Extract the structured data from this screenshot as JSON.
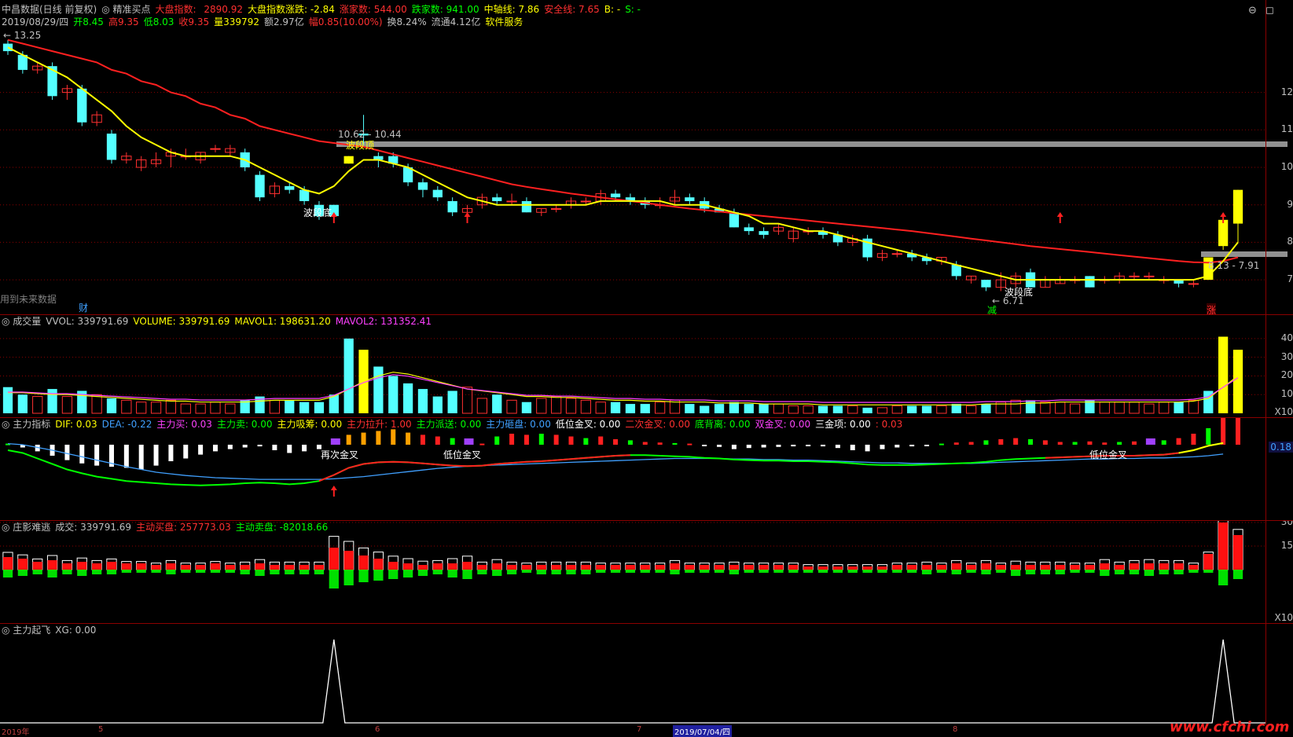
{
  "header": {
    "line1": [
      {
        "t": "中昌数据(日线 前复权)",
        "c": "#c0c0c0",
        "n": "stock-title"
      },
      {
        "t": "◎ 精准买点",
        "c": "#c0c0c0",
        "n": "indicator-name"
      },
      {
        "t": "大盘指数: ",
        "c": "#ff3030",
        "n": "index-label"
      },
      {
        "t": "2890.92",
        "c": "#ff3030",
        "n": "index-value"
      },
      {
        "t": "大盘指数涨跌: -2.84",
        "c": "#ffff00",
        "n": "index-change"
      },
      {
        "t": "涨家数: 544.00",
        "c": "#ff3030",
        "n": "up-count"
      },
      {
        "t": "跌家数: 941.00",
        "c": "#00ff00",
        "n": "down-count"
      },
      {
        "t": "中轴线: 7.86",
        "c": "#ffff00",
        "n": "mid-line"
      },
      {
        "t": "安全线: 7.65",
        "c": "#ff3030",
        "n": "safe-line"
      },
      {
        "t": "B: -",
        "c": "#ffff00",
        "n": "b-value"
      },
      {
        "t": "S: -",
        "c": "#00ff00",
        "n": "s-value"
      }
    ],
    "line2": [
      {
        "t": "2019/08/29/四",
        "c": "#c0c0c0",
        "n": "date"
      },
      {
        "t": "开8.45",
        "c": "#00ff00",
        "n": "open"
      },
      {
        "t": "高9.35",
        "c": "#ff3030",
        "n": "high"
      },
      {
        "t": "低8.03",
        "c": "#00ff00",
        "n": "low"
      },
      {
        "t": "收9.35",
        "c": "#ff3030",
        "n": "close"
      },
      {
        "t": "量339792",
        "c": "#ffff00",
        "n": "volume"
      },
      {
        "t": "额2.97亿",
        "c": "#c0c0c0",
        "n": "amount"
      },
      {
        "t": "幅0.85(10.00%)",
        "c": "#ff3030",
        "n": "change"
      },
      {
        "t": "换8.24%",
        "c": "#c0c0c0",
        "n": "turnover"
      },
      {
        "t": "流通4.12亿",
        "c": "#c0c0c0",
        "n": "float-cap"
      },
      {
        "t": "软件服务",
        "c": "#ffff00",
        "n": "sector"
      }
    ]
  },
  "main_labels": {
    "top_price": "13.25",
    "future_data": "用到未来数据",
    "cai": "财",
    "jian": "减",
    "zhang": "涨",
    "wave_top": "波段顶",
    "wave_bottom1": "波段底",
    "wave_bottom2": "波段底",
    "range1": "10.62 - 10.44",
    "range2": "8.13 - 7.91",
    "low_price": "6.71"
  },
  "main_axis": [
    "12",
    "11",
    "10",
    "9",
    "8",
    "7"
  ],
  "vol_header": [
    {
      "t": "◎ 成交量",
      "c": "#c0c0c0"
    },
    {
      "t": "VVOL: 339791.69",
      "c": "#c0c0c0"
    },
    {
      "t": "VOLUME: 339791.69",
      "c": "#ffff00"
    },
    {
      "t": "MAVOL1: 198631.20",
      "c": "#ffff00"
    },
    {
      "t": "MAVOL2: 131352.41",
      "c": "#ff40ff"
    }
  ],
  "vol_axis": [
    "40",
    "30",
    "20",
    "10",
    "X10"
  ],
  "macd_header": [
    {
      "t": "◎ 主力指标",
      "c": "#c0c0c0"
    },
    {
      "t": "DIF: 0.03",
      "c": "#ffff00"
    },
    {
      "t": "DEA: -0.22",
      "c": "#40a0ff"
    },
    {
      "t": "主力买: 0.03",
      "c": "#ff40ff"
    },
    {
      "t": "主力卖: 0.00",
      "c": "#00ff00"
    },
    {
      "t": "主力吸筹: 0.00",
      "c": "#ffff00"
    },
    {
      "t": "主力拉升: 1.00",
      "c": "#ff3030"
    },
    {
      "t": "主力派送: 0.00",
      "c": "#00ff00"
    },
    {
      "t": "主力砸盘: 0.00",
      "c": "#40a0ff"
    },
    {
      "t": "低位金叉: 0.00",
      "c": "#ffffff"
    },
    {
      "t": "二次金叉: 0.00",
      "c": "#ff3030"
    },
    {
      "t": "底背离: 0.00",
      "c": "#00ff00"
    },
    {
      "t": "双金叉: 0.00",
      "c": "#ff40ff"
    },
    {
      "t": "三金项: 0.00",
      "c": "#ffffff"
    },
    {
      "t": ": 0.03",
      "c": "#ff3030"
    }
  ],
  "macd_labels": {
    "gold1": "再次金叉",
    "gold2": "低位金叉",
    "gold3": "低位金叉",
    "axis_val": "0.18"
  },
  "flow_header": [
    {
      "t": "◎ 庄影难逃",
      "c": "#c0c0c0"
    },
    {
      "t": "成交: 339791.69",
      "c": "#c0c0c0"
    },
    {
      "t": "主动买盘: 257773.03",
      "c": "#ff3030"
    },
    {
      "t": "主动卖盘: -82018.66",
      "c": "#00ff00"
    }
  ],
  "flow_axis": [
    "30",
    "15",
    "X10"
  ],
  "xg_header": [
    {
      "t": "◎ 主力起飞",
      "c": "#c0c0c0"
    },
    {
      "t": "XG: 0.00",
      "c": "#c0c0c0"
    }
  ],
  "date_axis": [
    "2019年",
    "5",
    "6",
    "7",
    "2019/07/04/四",
    "8"
  ],
  "watermark": "www.cfchi.com",
  "colors": {
    "up": "#ff3030",
    "down": "#54ffff",
    "ma_fast": "#ffff00",
    "ma_slow": "#ff2020",
    "grid": "#8b0000"
  },
  "candles": [
    {
      "o": 13.3,
      "c": 13.1,
      "h": 13.4,
      "l": 13.0
    },
    {
      "o": 13.0,
      "c": 12.6,
      "h": 13.1,
      "l": 12.5
    },
    {
      "o": 12.6,
      "c": 12.7,
      "h": 12.8,
      "l": 12.5
    },
    {
      "o": 12.7,
      "c": 11.9,
      "h": 12.8,
      "l": 11.8
    },
    {
      "o": 12.0,
      "c": 12.1,
      "h": 12.2,
      "l": 11.8
    },
    {
      "o": 12.1,
      "c": 11.2,
      "h": 12.2,
      "l": 11.1
    },
    {
      "o": 11.2,
      "c": 11.4,
      "h": 11.5,
      "l": 11.1
    },
    {
      "o": 10.9,
      "c": 10.2,
      "h": 11.0,
      "l": 10.1
    },
    {
      "o": 10.2,
      "c": 10.3,
      "h": 10.4,
      "l": 10.1
    },
    {
      "o": 10.0,
      "c": 10.2,
      "h": 10.3,
      "l": 9.9
    },
    {
      "o": 10.1,
      "c": 10.2,
      "h": 10.4,
      "l": 10.0
    },
    {
      "o": 10.3,
      "c": 10.4,
      "h": 10.5,
      "l": 10.0
    },
    {
      "o": 10.3,
      "c": 10.3,
      "h": 10.5,
      "l": 10.2
    },
    {
      "o": 10.2,
      "c": 10.4,
      "h": 10.4,
      "l": 10.1
    },
    {
      "o": 10.5,
      "c": 10.5,
      "h": 10.6,
      "l": 10.4
    },
    {
      "o": 10.4,
      "c": 10.5,
      "h": 10.6,
      "l": 10.3
    },
    {
      "o": 10.4,
      "c": 10.0,
      "h": 10.5,
      "l": 9.9
    },
    {
      "o": 9.8,
      "c": 9.2,
      "h": 9.9,
      "l": 9.1
    },
    {
      "o": 9.3,
      "c": 9.5,
      "h": 9.6,
      "l": 9.2
    },
    {
      "o": 9.5,
      "c": 9.4,
      "h": 9.6,
      "l": 9.3
    },
    {
      "o": 9.4,
      "c": 9.1,
      "h": 9.5,
      "l": 9.0
    },
    {
      "o": 9.0,
      "c": 8.7,
      "h": 9.1,
      "l": 8.6
    },
    {
      "o": 9.0,
      "c": 8.7,
      "h": 9.0,
      "l": 8.6
    },
    {
      "o": 10.3,
      "c": 10.1,
      "h": 10.3,
      "l": 10.1
    },
    {
      "o": 10.9,
      "c": 10.85,
      "h": 11.4,
      "l": 10.6
    },
    {
      "o": 10.3,
      "c": 10.2,
      "h": 10.4,
      "l": 10.0
    },
    {
      "o": 10.3,
      "c": 10.1,
      "h": 10.4,
      "l": 10.0
    },
    {
      "o": 10.0,
      "c": 9.6,
      "h": 10.1,
      "l": 9.5
    },
    {
      "o": 9.6,
      "c": 9.4,
      "h": 9.7,
      "l": 9.2
    },
    {
      "o": 9.4,
      "c": 9.2,
      "h": 9.5,
      "l": 9.1
    },
    {
      "o": 9.1,
      "c": 8.8,
      "h": 9.2,
      "l": 8.7
    },
    {
      "o": 8.8,
      "c": 8.9,
      "h": 9.0,
      "l": 8.7
    },
    {
      "o": 9.0,
      "c": 9.2,
      "h": 9.3,
      "l": 8.9
    },
    {
      "o": 9.2,
      "c": 9.1,
      "h": 9.3,
      "l": 9.0
    },
    {
      "o": 9.1,
      "c": 9.1,
      "h": 9.3,
      "l": 9.0
    },
    {
      "o": 9.1,
      "c": 8.8,
      "h": 9.2,
      "l": 8.8
    },
    {
      "o": 8.8,
      "c": 8.9,
      "h": 8.9,
      "l": 8.7
    },
    {
      "o": 8.9,
      "c": 8.9,
      "h": 9.0,
      "l": 8.8
    },
    {
      "o": 9.0,
      "c": 9.1,
      "h": 9.2,
      "l": 8.9
    },
    {
      "o": 9.1,
      "c": 9.1,
      "h": 9.2,
      "l": 9.0
    },
    {
      "o": 9.1,
      "c": 9.3,
      "h": 9.4,
      "l": 9.0
    },
    {
      "o": 9.3,
      "c": 9.2,
      "h": 9.4,
      "l": 9.1
    },
    {
      "o": 9.2,
      "c": 9.1,
      "h": 9.3,
      "l": 9.0
    },
    {
      "o": 9.1,
      "c": 9.0,
      "h": 9.2,
      "l": 8.9
    },
    {
      "o": 9.0,
      "c": 9.0,
      "h": 9.2,
      "l": 8.9
    },
    {
      "o": 9.1,
      "c": 9.2,
      "h": 9.4,
      "l": 9.0
    },
    {
      "o": 9.2,
      "c": 9.1,
      "h": 9.3,
      "l": 9.0
    },
    {
      "o": 9.1,
      "c": 8.9,
      "h": 9.2,
      "l": 8.8
    },
    {
      "o": 8.9,
      "c": 8.8,
      "h": 9.0,
      "l": 8.8
    },
    {
      "o": 8.8,
      "c": 8.4,
      "h": 8.9,
      "l": 8.4
    },
    {
      "o": 8.4,
      "c": 8.3,
      "h": 8.5,
      "l": 8.2
    },
    {
      "o": 8.3,
      "c": 8.2,
      "h": 8.4,
      "l": 8.1
    },
    {
      "o": 8.3,
      "c": 8.4,
      "h": 8.5,
      "l": 8.2
    },
    {
      "o": 8.1,
      "c": 8.3,
      "h": 8.4,
      "l": 8.0
    },
    {
      "o": 8.3,
      "c": 8.3,
      "h": 8.4,
      "l": 8.2
    },
    {
      "o": 8.3,
      "c": 8.2,
      "h": 8.4,
      "l": 8.1
    },
    {
      "o": 8.2,
      "c": 8.0,
      "h": 8.3,
      "l": 7.9
    },
    {
      "o": 8.0,
      "c": 8.1,
      "h": 8.2,
      "l": 7.9
    },
    {
      "o": 8.1,
      "c": 7.6,
      "h": 8.2,
      "l": 7.5
    },
    {
      "o": 7.6,
      "c": 7.7,
      "h": 7.8,
      "l": 7.5
    },
    {
      "o": 7.7,
      "c": 7.7,
      "h": 7.8,
      "l": 7.6
    },
    {
      "o": 7.7,
      "c": 7.6,
      "h": 7.8,
      "l": 7.5
    },
    {
      "o": 7.6,
      "c": 7.5,
      "h": 7.7,
      "l": 7.4
    },
    {
      "o": 7.5,
      "c": 7.6,
      "h": 7.6,
      "l": 7.4
    },
    {
      "o": 7.4,
      "c": 7.1,
      "h": 7.5,
      "l": 7.0
    },
    {
      "o": 7.0,
      "c": 7.1,
      "h": 7.1,
      "l": 6.9
    },
    {
      "o": 7.0,
      "c": 6.8,
      "h": 7.0,
      "l": 6.7
    },
    {
      "o": 6.8,
      "c": 7.0,
      "h": 7.2,
      "l": 6.7
    },
    {
      "o": 6.9,
      "c": 7.1,
      "h": 7.2,
      "l": 6.8
    },
    {
      "o": 7.2,
      "c": 6.8,
      "h": 7.3,
      "l": 6.8
    },
    {
      "o": 6.8,
      "c": 7.0,
      "h": 7.1,
      "l": 6.8
    },
    {
      "o": 6.9,
      "c": 7.0,
      "h": 7.1,
      "l": 6.9
    },
    {
      "o": 7.0,
      "c": 7.0,
      "h": 7.1,
      "l": 6.9
    },
    {
      "o": 7.1,
      "c": 6.8,
      "h": 7.1,
      "l": 6.8
    },
    {
      "o": 7.0,
      "c": 7.0,
      "h": 7.1,
      "l": 6.9
    },
    {
      "o": 7.0,
      "c": 7.1,
      "h": 7.2,
      "l": 6.9
    },
    {
      "o": 7.1,
      "c": 7.1,
      "h": 7.2,
      "l": 7.0
    },
    {
      "o": 7.1,
      "c": 7.1,
      "h": 7.2,
      "l": 7.0
    },
    {
      "o": 7.0,
      "c": 7.0,
      "h": 7.1,
      "l": 6.9
    },
    {
      "o": 7.0,
      "c": 6.9,
      "h": 7.0,
      "l": 6.8
    },
    {
      "o": 6.9,
      "c": 6.9,
      "h": 7.0,
      "l": 6.8
    },
    {
      "o": 7.6,
      "c": 7.0,
      "h": 7.6,
      "l": 7.0
    },
    {
      "o": 7.9,
      "c": 8.6,
      "h": 8.6,
      "l": 7.8
    },
    {
      "o": 8.5,
      "c": 9.4,
      "h": 9.4,
      "l": 8.0
    }
  ],
  "ma5": [
    13.2,
    13.0,
    12.8,
    12.6,
    12.4,
    12.1,
    11.8,
    11.5,
    11.1,
    10.8,
    10.6,
    10.4,
    10.3,
    10.3,
    10.3,
    10.3,
    10.2,
    10.0,
    9.8,
    9.6,
    9.4,
    9.3,
    9.5,
    9.9,
    10.2,
    10.2,
    10.1,
    10.0,
    9.8,
    9.6,
    9.4,
    9.2,
    9.1,
    9.0,
    9.0,
    9.0,
    9.0,
    9.0,
    9.0,
    9.0,
    9.1,
    9.1,
    9.1,
    9.1,
    9.1,
    9.0,
    9.0,
    9.0,
    8.9,
    8.8,
    8.7,
    8.5,
    8.5,
    8.4,
    8.3,
    8.3,
    8.2,
    8.1,
    8.0,
    7.9,
    7.8,
    7.7,
    7.6,
    7.5,
    7.4,
    7.3,
    7.2,
    7.1,
    7.0,
    7.0,
    7.0,
    7.0,
    7.0,
    7.0,
    7.0,
    7.0,
    7.0,
    7.0,
    7.0,
    7.0,
    7.0,
    7.1,
    7.5,
    8.0
  ],
  "ma_slow": [
    13.4,
    13.3,
    13.2,
    13.1,
    13.0,
    12.9,
    12.8,
    12.6,
    12.5,
    12.3,
    12.2,
    12.0,
    11.9,
    11.7,
    11.6,
    11.4,
    11.3,
    11.1,
    11.0,
    10.9,
    10.8,
    10.7,
    10.65,
    10.6,
    10.55,
    10.45,
    10.35,
    10.25,
    10.15,
    10.05,
    9.95,
    9.85,
    9.75,
    9.65,
    9.55,
    9.48,
    9.42,
    9.36,
    9.3,
    9.25,
    9.2,
    9.15,
    9.1,
    9.05,
    9.0,
    8.95,
    8.9,
    8.86,
    8.82,
    8.78,
    8.74,
    8.7,
    8.66,
    8.62,
    8.58,
    8.54,
    8.5,
    8.46,
    8.42,
    8.38,
    8.34,
    8.3,
    8.25,
    8.2,
    8.15,
    8.1,
    8.05,
    8.0,
    7.95,
    7.9,
    7.86,
    7.82,
    7.78,
    7.74,
    7.7,
    7.66,
    7.62,
    7.58,
    7.54,
    7.5,
    7.47,
    7.46,
    7.5,
    7.6
  ],
  "volumes": [
    14,
    10,
    9,
    13,
    9,
    12,
    10,
    8,
    7,
    6,
    6,
    7,
    5,
    5,
    6,
    5,
    7,
    9,
    7,
    7,
    6,
    6,
    10,
    40,
    34,
    25,
    20,
    16,
    13,
    9,
    12,
    14,
    8,
    10,
    7,
    6,
    8,
    9,
    8,
    7,
    6,
    6,
    5,
    5,
    6,
    7,
    5,
    4,
    5,
    6,
    5,
    5,
    5,
    4,
    4,
    4,
    4,
    4,
    3,
    3,
    4,
    4,
    4,
    4,
    5,
    4,
    5,
    6,
    7,
    7,
    6,
    6,
    5,
    7,
    6,
    6,
    6,
    5,
    6,
    6,
    7,
    12,
    41,
    34
  ],
  "vol_ma": [
    11,
    11,
    10.5,
    10,
    10,
    9.5,
    9,
    8.5,
    8,
    7.5,
    7,
    6.5,
    6.5,
    6,
    6,
    6,
    6,
    6.5,
    7,
    7,
    7,
    7,
    9,
    13,
    17,
    20,
    22,
    21,
    19,
    17,
    15,
    13,
    12,
    11,
    10,
    9,
    9,
    8.5,
    8.5,
    8,
    7.5,
    7,
    7,
    6.5,
    6.5,
    6,
    6,
    6,
    5.5,
    5.5,
    5.5,
    5,
    5,
    5,
    5,
    4.5,
    4.5,
    4.5,
    4.5,
    4.5,
    4.5,
    4.5,
    4.5,
    4.5,
    4.5,
    4.5,
    5,
    5,
    5,
    5.5,
    5.5,
    6,
    6,
    6,
    6,
    6,
    6,
    6,
    6,
    6,
    6.5,
    8,
    14,
    20
  ],
  "macd_bars": [
    0.02,
    -0.05,
    -0.12,
    -0.2,
    -0.28,
    -0.34,
    -0.38,
    -0.4,
    -0.42,
    -0.45,
    -0.38,
    -0.3,
    -0.25,
    -0.18,
    -0.12,
    -0.08,
    -0.05,
    -0.03,
    -0.1,
    -0.15,
    -0.12,
    -0.08,
    0.05,
    0.18,
    0.22,
    0.25,
    0.28,
    0.22,
    0.18,
    0.15,
    0.12,
    0.05,
    0.02,
    0.15,
    0.2,
    0.18,
    0.2,
    0.18,
    0.15,
    0.12,
    0.15,
    0.1,
    0.08,
    0.05,
    0.04,
    0.03,
    0.02,
    -0.02,
    -0.04,
    -0.08,
    -0.06,
    -0.05,
    -0.04,
    -0.03,
    -0.02,
    -0.03,
    -0.06,
    -0.1,
    -0.12,
    -0.08,
    -0.05,
    -0.03,
    -0.02,
    0.02,
    0.04,
    0.05,
    0.08,
    0.1,
    0.12,
    0.1,
    0.08,
    0.05,
    0.05,
    0.06,
    0.04,
    0.05,
    0.06,
    0.06,
    0.08,
    0.12,
    0.2,
    0.3,
    0.5,
    0.8
  ],
  "dif": [
    -0.1,
    -0.15,
    -0.25,
    -0.35,
    -0.45,
    -0.52,
    -0.58,
    -0.62,
    -0.66,
    -0.68,
    -0.7,
    -0.72,
    -0.73,
    -0.74,
    -0.73,
    -0.72,
    -0.7,
    -0.69,
    -0.7,
    -0.72,
    -0.7,
    -0.66,
    -0.55,
    -0.42,
    -0.35,
    -0.32,
    -0.31,
    -0.32,
    -0.34,
    -0.36,
    -0.38,
    -0.39,
    -0.38,
    -0.35,
    -0.33,
    -0.31,
    -0.3,
    -0.28,
    -0.26,
    -0.24,
    -0.22,
    -0.2,
    -0.19,
    -0.19,
    -0.2,
    -0.21,
    -0.22,
    -0.24,
    -0.25,
    -0.27,
    -0.28,
    -0.29,
    -0.29,
    -0.3,
    -0.3,
    -0.31,
    -0.32,
    -0.34,
    -0.36,
    -0.37,
    -0.37,
    -0.37,
    -0.36,
    -0.35,
    -0.34,
    -0.33,
    -0.31,
    -0.28,
    -0.26,
    -0.25,
    -0.24,
    -0.23,
    -0.22,
    -0.21,
    -0.2,
    -0.2,
    -0.2,
    -0.19,
    -0.18,
    -0.15,
    -0.1,
    -0.02,
    0.03
  ],
  "dea": [
    0.02,
    0.0,
    -0.05,
    -0.1,
    -0.16,
    -0.22,
    -0.28,
    -0.34,
    -0.4,
    -0.45,
    -0.5,
    -0.53,
    -0.56,
    -0.58,
    -0.6,
    -0.61,
    -0.62,
    -0.63,
    -0.63,
    -0.63,
    -0.63,
    -0.63,
    -0.62,
    -0.6,
    -0.58,
    -0.55,
    -0.52,
    -0.49,
    -0.46,
    -0.43,
    -0.41,
    -0.39,
    -0.38,
    -0.37,
    -0.36,
    -0.35,
    -0.34,
    -0.33,
    -0.32,
    -0.31,
    -0.3,
    -0.29,
    -0.28,
    -0.27,
    -0.26,
    -0.25,
    -0.25,
    -0.25,
    -0.25,
    -0.26,
    -0.26,
    -0.27,
    -0.27,
    -0.28,
    -0.28,
    -0.29,
    -0.3,
    -0.31,
    -0.32,
    -0.33,
    -0.33,
    -0.34,
    -0.34,
    -0.34,
    -0.34,
    -0.34,
    -0.33,
    -0.32,
    -0.31,
    -0.3,
    -0.29,
    -0.28,
    -0.27,
    -0.26,
    -0.26,
    -0.25,
    -0.25,
    -0.24,
    -0.24,
    -0.23,
    -0.22,
    -0.2,
    -0.17
  ],
  "flow_buy": [
    8,
    7,
    5,
    6,
    4,
    5,
    4,
    5,
    4,
    4,
    3,
    4,
    3,
    3,
    4,
    3,
    3,
    4,
    3,
    3,
    3,
    3,
    14,
    12,
    9,
    7,
    5,
    4,
    3,
    4,
    4,
    5,
    3,
    4,
    3,
    3,
    3,
    3,
    3,
    3,
    3,
    3,
    3,
    3,
    3,
    4,
    3,
    3,
    3,
    3,
    3,
    3,
    3,
    3,
    2,
    2,
    2,
    2,
    2,
    2,
    3,
    3,
    3,
    3,
    4,
    3,
    4,
    3,
    3,
    3,
    3,
    3,
    3,
    3,
    4,
    3,
    4,
    4,
    4,
    4,
    3,
    10,
    30,
    22
  ],
  "flow_sell": [
    -5,
    -4,
    -3,
    -5,
    -3,
    -4,
    -3,
    -3,
    -2,
    -2,
    -2,
    -3,
    -2,
    -2,
    -2,
    -2,
    -3,
    -4,
    -3,
    -3,
    -3,
    -3,
    -12,
    -10,
    -8,
    -7,
    -6,
    -5,
    -4,
    -3,
    -5,
    -6,
    -3,
    -4,
    -3,
    -2,
    -3,
    -3,
    -3,
    -3,
    -2,
    -2,
    -2,
    -2,
    -2,
    -3,
    -2,
    -2,
    -2,
    -3,
    -2,
    -2,
    -2,
    -2,
    -2,
    -2,
    -2,
    -2,
    -2,
    -2,
    -2,
    -2,
    -3,
    -2,
    -3,
    -2,
    -3,
    -2,
    -4,
    -3,
    -3,
    -3,
    -2,
    -2,
    -4,
    -3,
    -3,
    -4,
    -3,
    -3,
    -2,
    -2,
    -10,
    -6
  ],
  "xg_peaks": [
    22,
    82
  ]
}
